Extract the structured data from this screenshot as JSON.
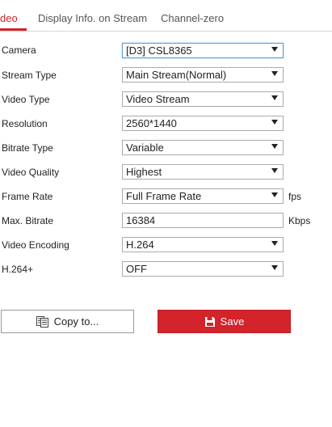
{
  "tabs": [
    {
      "label": "deo"
    },
    {
      "label": "Display Info. on Stream"
    },
    {
      "label": "Channel-zero"
    }
  ],
  "form": {
    "camera": {
      "label": "Camera",
      "value": "[D3] CSL8365"
    },
    "stream_type": {
      "label": "Stream Type",
      "value": "Main Stream(Normal)"
    },
    "video_type": {
      "label": "Video Type",
      "value": "Video Stream"
    },
    "resolution": {
      "label": "Resolution",
      "value": "2560*1440"
    },
    "bitrate_type": {
      "label": "Bitrate Type",
      "value": "Variable"
    },
    "video_quality": {
      "label": "Video Quality",
      "value": "Highest"
    },
    "frame_rate": {
      "label": "Frame Rate",
      "value": "Full Frame Rate",
      "unit": "fps"
    },
    "max_bitrate": {
      "label": "Max. Bitrate",
      "value": "16384",
      "unit": "Kbps"
    },
    "video_encoding": {
      "label": "Video Encoding",
      "value": "H.264"
    },
    "h264plus": {
      "label": "H.264+",
      "value": "OFF"
    }
  },
  "buttons": {
    "copy_label": "Copy to...",
    "save_label": "Save"
  },
  "colors": {
    "accent": "#d3232b"
  },
  "icons": {
    "copy": "copy-icon",
    "save": "floppy-disk-icon"
  }
}
